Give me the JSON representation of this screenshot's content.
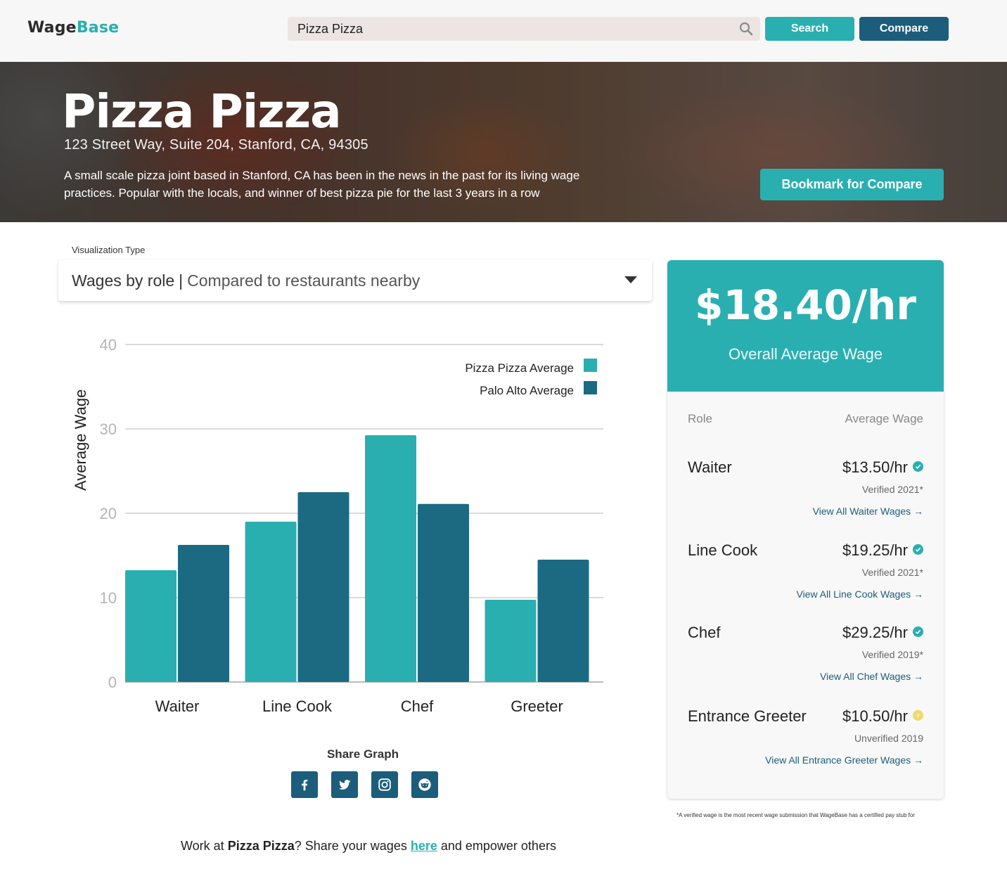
{
  "header": {
    "logo_part1": "Wage",
    "logo_part2": "Base",
    "search_value": "Pizza Pizza",
    "search_button": "Search",
    "compare_button": "Compare"
  },
  "hero": {
    "title": "Pizza Pizza",
    "address": "123 Street Way,  Suite 204, Stanford, CA, 94305",
    "description": "A small scale pizza joint based in Stanford, CA has been in the news in the past for its living wage practices. Popular with the locals, and winner of best pizza pie for the last 3 years in a row",
    "bookmark_button": "Bookmark for Compare"
  },
  "visualization": {
    "label": "Visualization Type",
    "selected_main": "Wages by role",
    "separator": "|",
    "selected_sub": "Compared to restaurants nearby"
  },
  "chart_data": {
    "type": "bar",
    "categories": [
      "Waiter",
      "Line Cook",
      "Chef",
      "Greeter"
    ],
    "series": [
      {
        "name": "Pizza Pizza Average",
        "values": [
          13.25,
          19,
          29.25,
          9.75
        ],
        "color": "#2aafb1"
      },
      {
        "name": "Palo Alto Average",
        "values": [
          16.25,
          22.5,
          21.1,
          14.5
        ],
        "color": "#1b6a82"
      }
    ],
    "ylabel": "Average Wage",
    "xlabel": "",
    "ylim": [
      0,
      40
    ],
    "yticks": [
      "0",
      "10",
      "20",
      "30",
      "40"
    ],
    "grid": true,
    "legend_position": "top-right"
  },
  "share": {
    "label": "Share Graph",
    "icons": [
      "facebook-icon",
      "twitter-icon",
      "instagram-icon",
      "reddit-icon"
    ]
  },
  "cta": {
    "prefix": "Work at ",
    "company": "Pizza Pizza",
    "middle": "? Share your wages ",
    "link": "here",
    "suffix": " and empower others"
  },
  "summary": {
    "overall_wage": "$18.40/hr",
    "overall_label": "Overall Average Wage",
    "col_role": "Role",
    "col_wage": "Average Wage",
    "roles": [
      {
        "name": "Waiter",
        "wage": "$13.50/hr",
        "status": "Verified 2021*",
        "verified": true,
        "link": "View All Waiter Wages →"
      },
      {
        "name": "Line Cook",
        "wage": "$19.25/hr",
        "status": "Verified 2021*",
        "verified": true,
        "link": "View All Line Cook Wages →"
      },
      {
        "name": "Chef",
        "wage": "$29.25/hr",
        "status": "Verified 2019*",
        "verified": true,
        "link": "View All Chef Wages →"
      },
      {
        "name": "Entrance Greeter",
        "wage": "$10.50/hr",
        "status": "Unverified 2019",
        "verified": false,
        "link": "View All Entrance Greeter Wages →"
      }
    ]
  },
  "footnote": "*A verified wage is the most recent wage submission that WageBase has a certified pay stub for",
  "colors": {
    "accent": "#2aafb1",
    "dark": "#1b5d7a",
    "warning": "#f3d86a"
  }
}
